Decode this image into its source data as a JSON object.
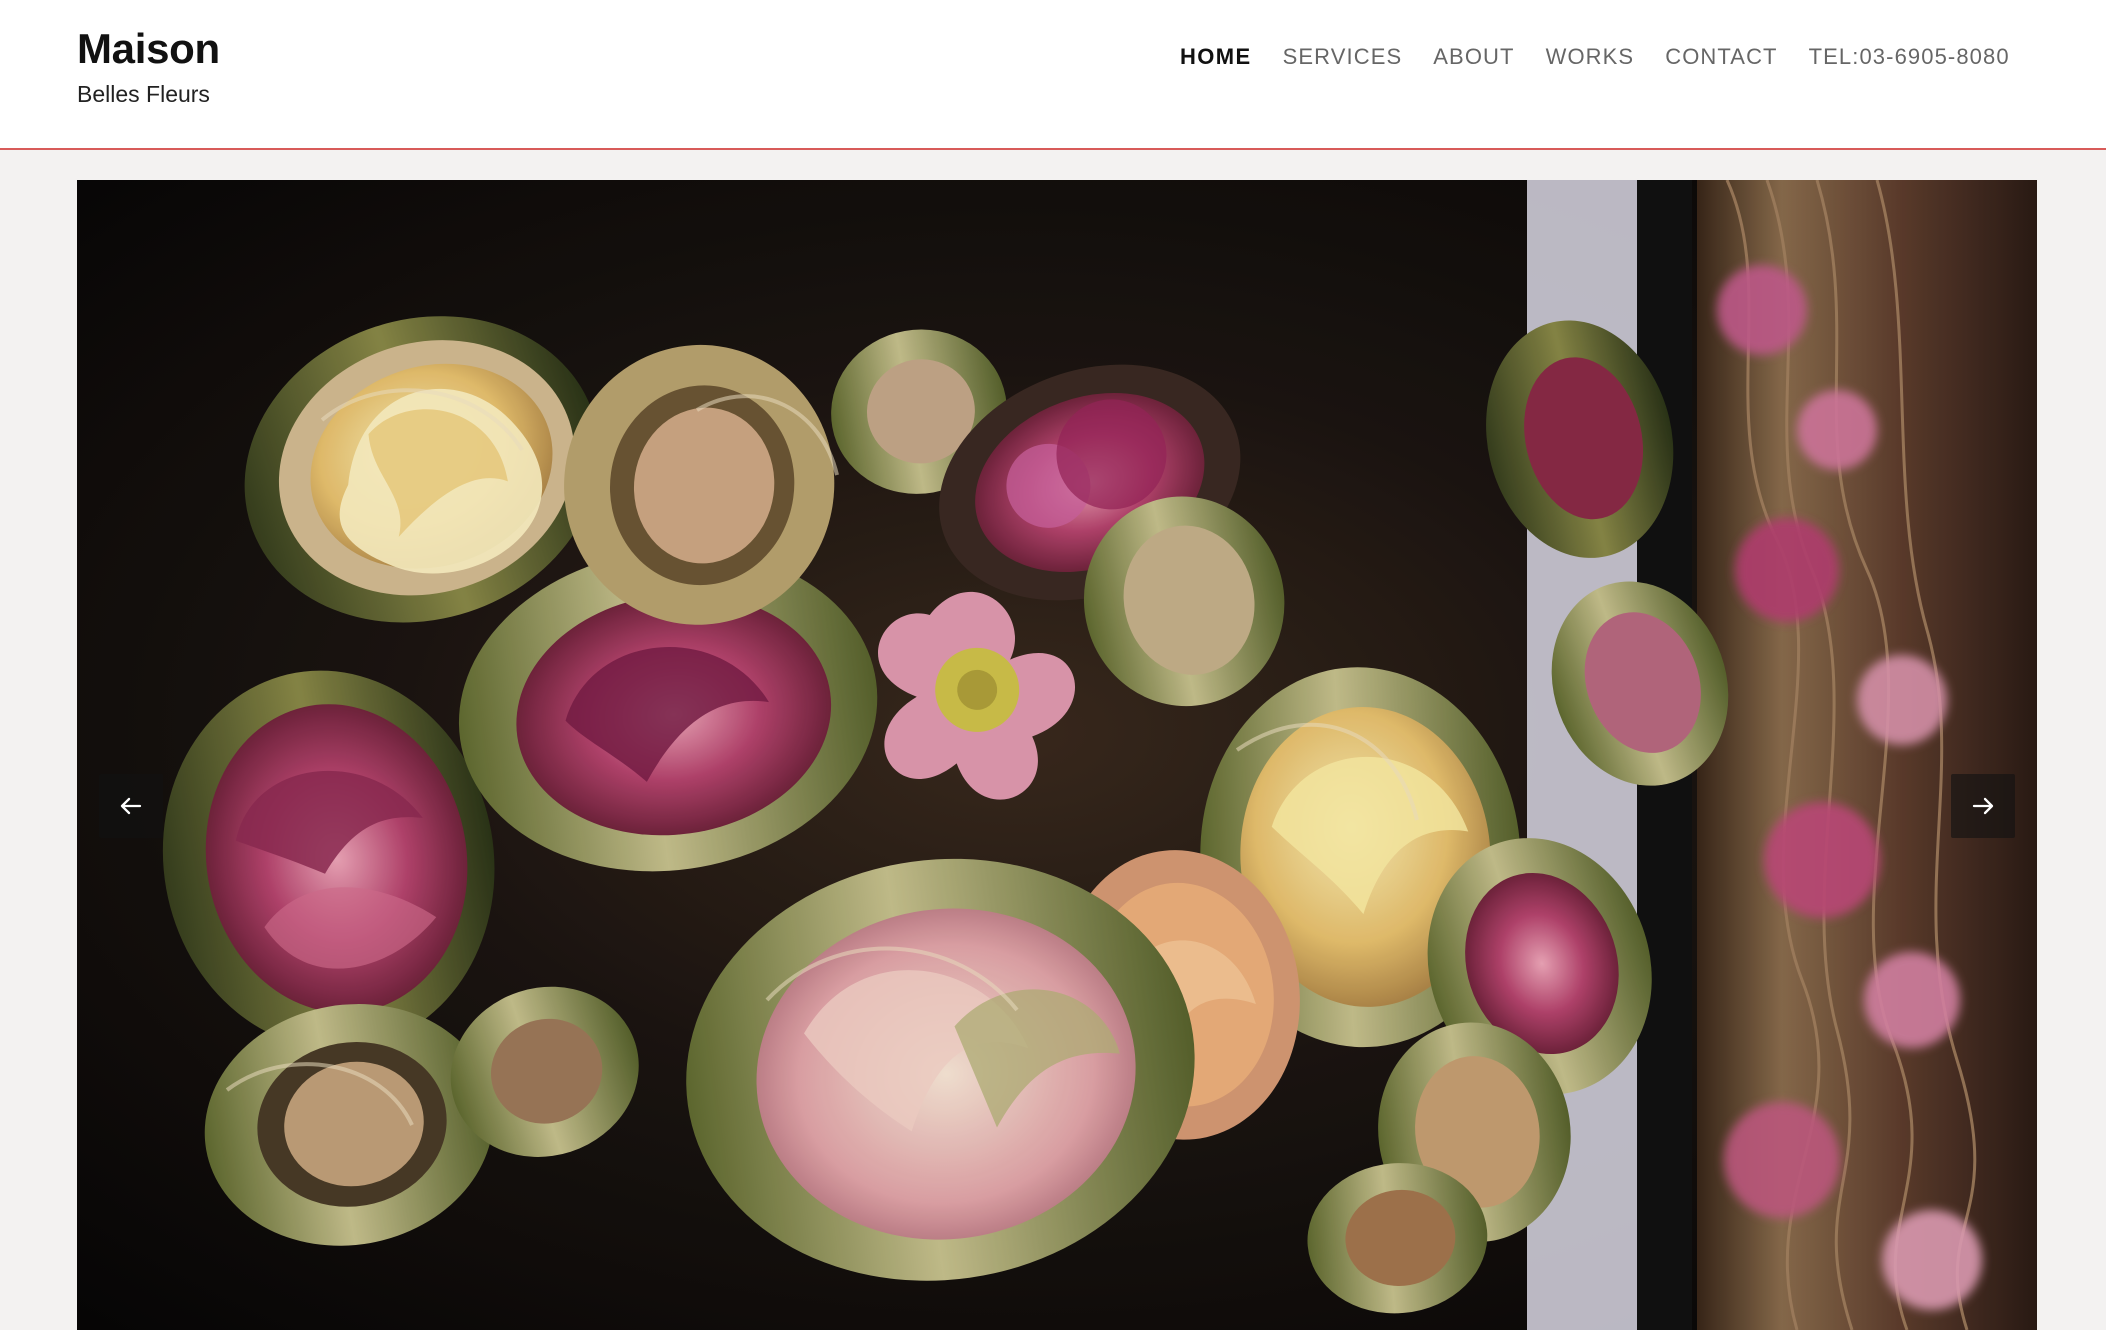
{
  "brand": {
    "name": "Maison",
    "subtitle": "Belles Fleurs"
  },
  "nav": {
    "home": "HOME",
    "services": "SERVICES",
    "about": "ABOUT",
    "works": "WORKS",
    "contact": "CONTACT",
    "tel": "TEL:03-6905-8080"
  },
  "hero": {
    "prev_icon": "arrow-left-icon",
    "next_icon": "arrow-right-icon",
    "image_subject": "floral-bamboo-arrangement"
  },
  "colors": {
    "header_bg": "#ffffff",
    "header_border": "#d85b59",
    "active_nav": "#111111",
    "nav_text": "#666666",
    "page_bg": "#f3f2f1"
  }
}
